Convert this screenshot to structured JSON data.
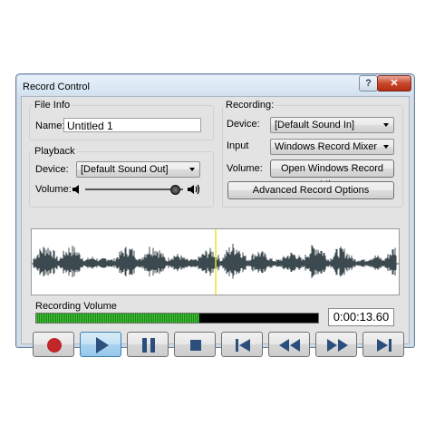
{
  "window": {
    "title": "Record Control",
    "help_glyph": "?",
    "close_glyph": "✕"
  },
  "file_info": {
    "group_label": "File Info",
    "name_label": "Name:",
    "name_value": "Untitled 1"
  },
  "playback": {
    "group_label": "Playback",
    "device_label": "Device:",
    "device_value": "[Default Sound Out]",
    "volume_label": "Volume:",
    "volume_level": 0.97
  },
  "recording": {
    "group_label": "Recording:",
    "device_label": "Device:",
    "device_value": "[Default Sound In]",
    "input_label": "Input",
    "input_value": "Windows Record Mixer",
    "volume_label": "Volume:",
    "open_mixer_label": "Open Windows Record Mixer",
    "advanced_label": "Advanced Record Options"
  },
  "recording_volume": {
    "label": "Recording Volume",
    "level": 0.58
  },
  "time_display": "0:00:13.60",
  "transport": [
    {
      "name": "record-button",
      "icon": "record-icon"
    },
    {
      "name": "play-button",
      "icon": "play-icon",
      "pressed": true
    },
    {
      "name": "pause-button",
      "icon": "pause-icon"
    },
    {
      "name": "stop-button",
      "icon": "stop-icon"
    },
    {
      "name": "go-to-start-button",
      "icon": "skip-start-icon"
    },
    {
      "name": "rewind-button",
      "icon": "rewind-icon"
    },
    {
      "name": "fast-forward-button",
      "icon": "fast-forward-icon"
    },
    {
      "name": "go-to-end-button",
      "icon": "skip-end-icon"
    }
  ],
  "colors": {
    "record_red": "#c0262a",
    "icon_blue": "#2a4f7c",
    "meter_green": "#3fbf33",
    "playhead": "#e6e62a",
    "waveform": "#3c4a50"
  }
}
